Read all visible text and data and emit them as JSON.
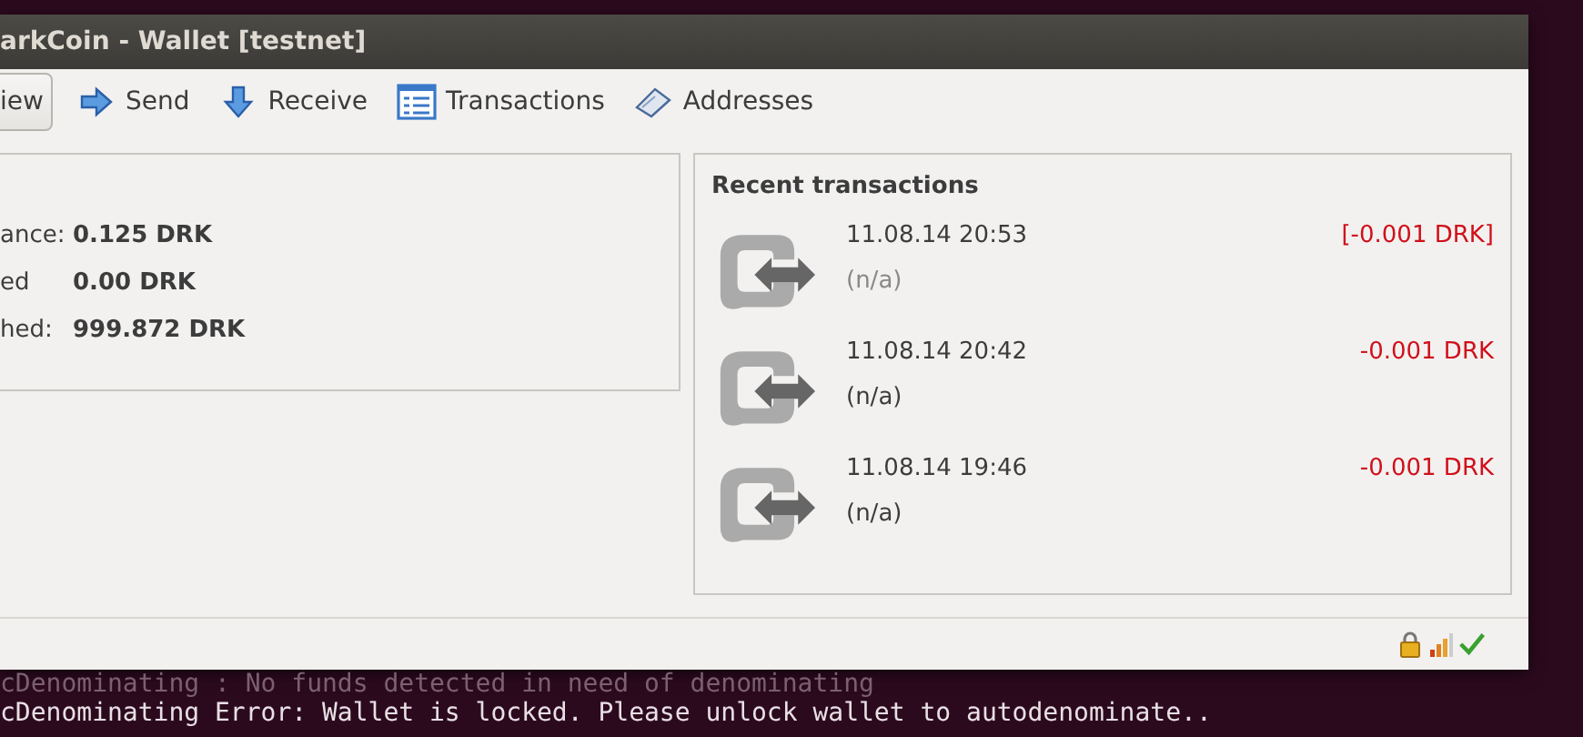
{
  "window": {
    "title": "arkCoin - Wallet [testnet]"
  },
  "toolbar": [
    {
      "label": "iew",
      "kind": "overview",
      "selected": true
    },
    {
      "label": "Send",
      "kind": "send",
      "selected": false
    },
    {
      "label": "Receive",
      "kind": "receive",
      "selected": false
    },
    {
      "label": "Transactions",
      "kind": "transactions",
      "selected": false
    },
    {
      "label": "Addresses",
      "kind": "addresses",
      "selected": false
    }
  ],
  "balances": [
    {
      "label": "ance:",
      "value": "0.125 DRK"
    },
    {
      "label": "ed",
      "value": "0.00 DRK"
    },
    {
      "label": "hed:",
      "value": "999.872 DRK"
    }
  ],
  "recent": {
    "title": "Recent transactions",
    "items": [
      {
        "date": "11.08.14 20:53",
        "address": "(n/a)",
        "amount": "[-0.001 DRK]",
        "confirmed": false
      },
      {
        "date": "11.08.14 20:42",
        "address": "(n/a)",
        "amount": "-0.001 DRK",
        "confirmed": true
      },
      {
        "date": "11.08.14 19:46",
        "address": "(n/a)",
        "amount": "-0.001 DRK",
        "confirmed": true
      }
    ]
  },
  "terminal_bottom": [
    {
      "text": "cDenominating : No funds detected in need of denominating",
      "faded": true
    },
    {
      "text": "cDenominating Error: Wallet is locked. Please unlock wallet to autodenominate..",
      "faded": false
    }
  ]
}
